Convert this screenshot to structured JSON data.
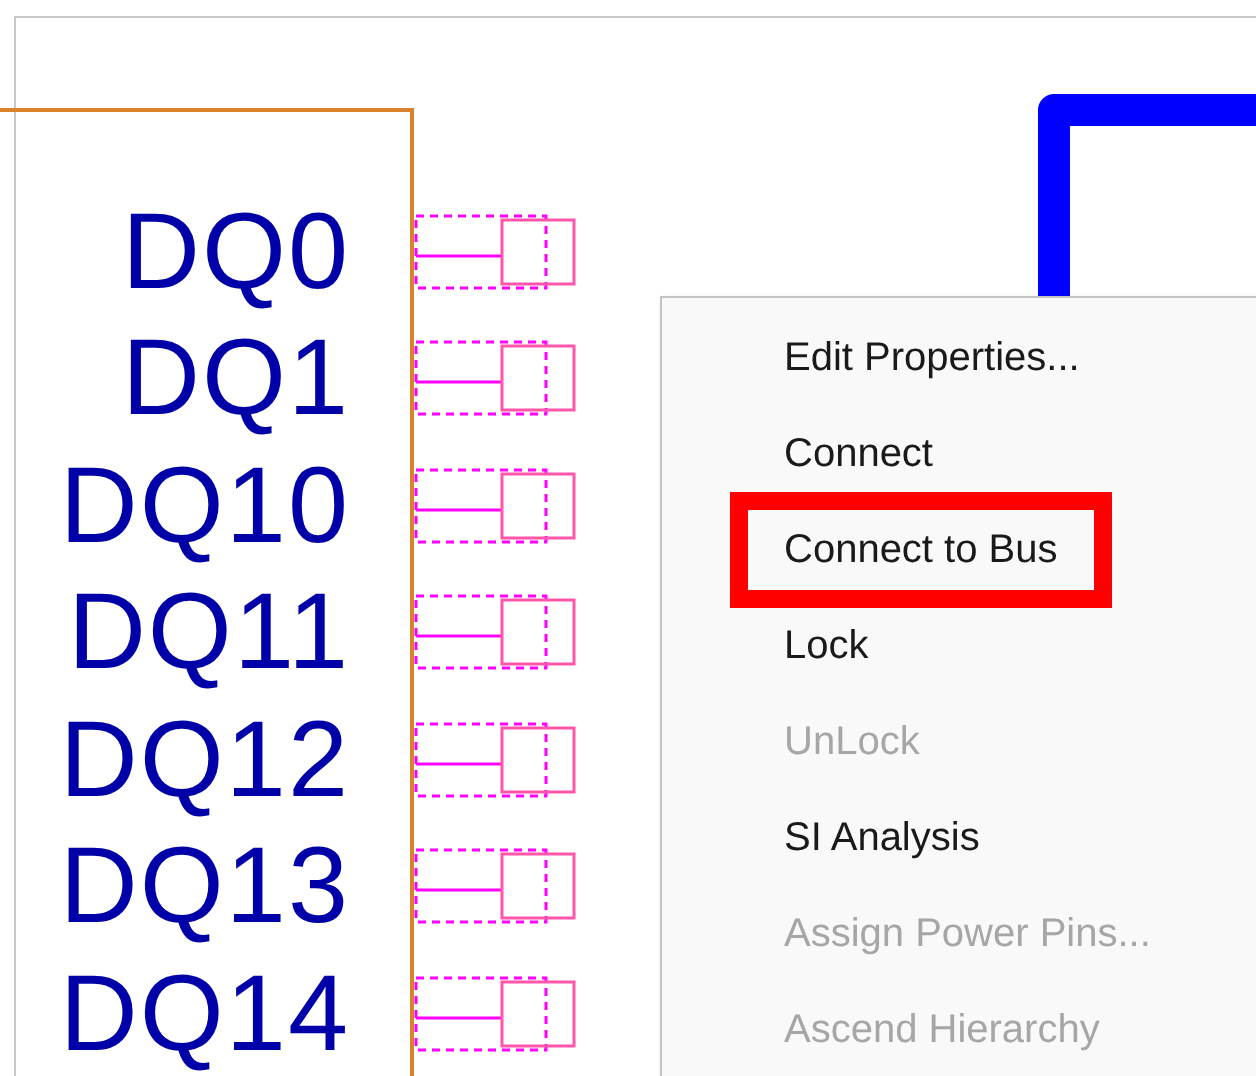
{
  "pins": [
    {
      "label": "DQ0"
    },
    {
      "label": "DQ1"
    },
    {
      "label": "DQ10"
    },
    {
      "label": "DQ11"
    },
    {
      "label": "DQ12"
    },
    {
      "label": "DQ13"
    },
    {
      "label": "DQ14"
    }
  ],
  "context_menu": {
    "items": [
      {
        "label": "Edit Properties...",
        "disabled": false,
        "highlighted": false
      },
      {
        "label": "Connect",
        "disabled": false,
        "highlighted": false
      },
      {
        "label": "Connect to Bus",
        "disabled": false,
        "highlighted": true
      },
      {
        "label": "Lock",
        "disabled": false,
        "highlighted": false
      },
      {
        "label": "UnLock",
        "disabled": true,
        "highlighted": false
      },
      {
        "label": "SI Analysis",
        "disabled": false,
        "highlighted": false
      },
      {
        "label": "Assign Power Pins...",
        "disabled": true,
        "highlighted": false
      },
      {
        "label": "Ascend Hierarchy",
        "disabled": true,
        "highlighted": false
      }
    ]
  }
}
